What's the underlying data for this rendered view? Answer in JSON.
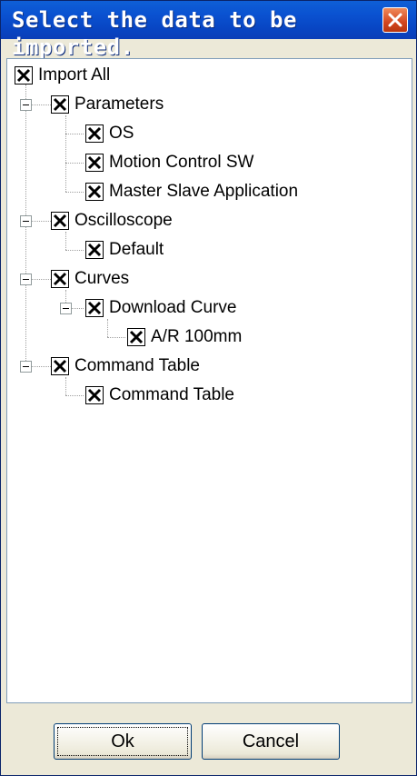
{
  "window": {
    "title": "Select the data to be imported.",
    "close_icon": "close-icon"
  },
  "tree": {
    "root": {
      "label": "Import All",
      "checked": true
    },
    "parameters": {
      "label": "Parameters",
      "checked": true,
      "expanded": true,
      "children": [
        {
          "label": "OS",
          "checked": true
        },
        {
          "label": "Motion Control SW",
          "checked": true
        },
        {
          "label": "Master Slave Application",
          "checked": true
        }
      ]
    },
    "oscilloscope": {
      "label": "Oscilloscope",
      "checked": true,
      "expanded": true,
      "children": [
        {
          "label": "Default",
          "checked": true
        }
      ]
    },
    "curves": {
      "label": "Curves",
      "checked": true,
      "expanded": true,
      "download_curve": {
        "label": "Download Curve",
        "checked": true,
        "expanded": true,
        "children": [
          {
            "label": "A/R 100mm",
            "checked": true
          }
        ]
      }
    },
    "command_table": {
      "label": "Command Table",
      "checked": true,
      "expanded": true,
      "children": [
        {
          "label": "Command Table",
          "checked": true
        }
      ]
    }
  },
  "buttons": {
    "ok": "Ok",
    "cancel": "Cancel"
  },
  "colors": {
    "titlebar": "#0a52d1",
    "close": "#d3461f",
    "face": "#ece9d8"
  }
}
